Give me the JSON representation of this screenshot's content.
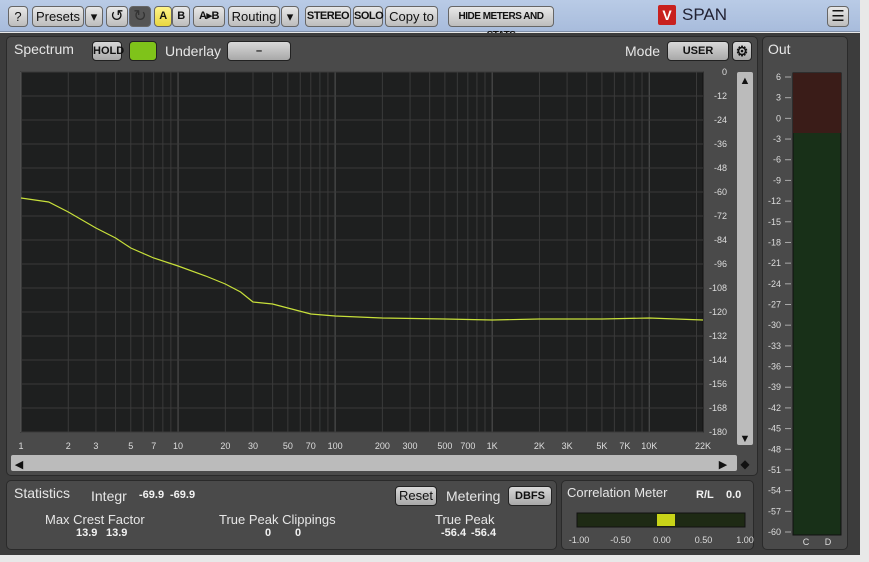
{
  "toolbar": {
    "help": "?",
    "presets": "Presets",
    "dropdown": "▾",
    "undo": "↺",
    "redo": "↻",
    "a": "A",
    "b": "B",
    "ab": "A▸B",
    "routing": "Routing",
    "stereo": "STEREO",
    "solo": "SOLO",
    "copy_to": "Copy to",
    "hide_meters": "HIDE METERS AND STATS",
    "brand": "SPAN",
    "menu": "☰"
  },
  "spectrum": {
    "tab": "Spectrum",
    "hold": "HOLD",
    "hold_on_color": "#7fc31a",
    "underlay_label": "Underlay",
    "underlay_value": "–",
    "mode_label": "Mode",
    "mode_value": "USER",
    "line_color": "#c8e03a"
  },
  "chart_data": {
    "type": "line",
    "x_scale": "log",
    "xlim": [
      1,
      22000
    ],
    "ylim": [
      -180,
      0
    ],
    "x_ticks": [
      {
        "v": 1,
        "t": "1"
      },
      {
        "v": 2,
        "t": "2"
      },
      {
        "v": 3,
        "t": "3"
      },
      {
        "v": 5,
        "t": "5"
      },
      {
        "v": 7,
        "t": "7"
      },
      {
        "v": 10,
        "t": "10"
      },
      {
        "v": 20,
        "t": "20"
      },
      {
        "v": 30,
        "t": "30"
      },
      {
        "v": 50,
        "t": "50"
      },
      {
        "v": 70,
        "t": "70"
      },
      {
        "v": 100,
        "t": "100"
      },
      {
        "v": 200,
        "t": "200"
      },
      {
        "v": 300,
        "t": "300"
      },
      {
        "v": 500,
        "t": "500"
      },
      {
        "v": 700,
        "t": "700"
      },
      {
        "v": 1000,
        "t": "1K"
      },
      {
        "v": 2000,
        "t": "2K"
      },
      {
        "v": 3000,
        "t": "3K"
      },
      {
        "v": 5000,
        "t": "5K"
      },
      {
        "v": 7000,
        "t": "7K"
      },
      {
        "v": 10000,
        "t": "10K"
      },
      {
        "v": 22000,
        "t": "22K"
      }
    ],
    "y_ticks": [
      "0",
      "-12",
      "-24",
      "-36",
      "-48",
      "-60",
      "-72",
      "-84",
      "-96",
      "-108",
      "-120",
      "-132",
      "-144",
      "-156",
      "-168",
      "-180"
    ],
    "x": [
      1,
      1.5,
      2,
      3,
      4,
      5,
      7,
      10,
      15,
      20,
      25,
      30,
      40,
      50,
      70,
      100,
      200,
      500,
      1000,
      2000,
      5000,
      10000,
      22000
    ],
    "y": [
      -63,
      -65,
      -70,
      -78,
      -83,
      -88,
      -93,
      -97,
      -102,
      -106,
      -110,
      -115,
      -116,
      -118,
      -121,
      -122,
      -123,
      -123.5,
      -124,
      -123.5,
      -123.5,
      -123,
      -124
    ]
  },
  "out": {
    "tab": "Out",
    "scale": [
      "6",
      "3",
      "0",
      "-3",
      "-6",
      "-9",
      "-12",
      "-15",
      "-18",
      "-21",
      "-24",
      "-27",
      "-30",
      "-33",
      "-36",
      "-39",
      "-42",
      "-45",
      "-48",
      "-51",
      "-54",
      "-57",
      "-60"
    ],
    "channels": [
      "C",
      "D"
    ]
  },
  "stats": {
    "tab": "Statistics",
    "integr_label": "Integr",
    "integr": [
      "-69.9",
      "-69.9"
    ],
    "reset": "Reset",
    "metering_label": "Metering",
    "metering_value": "DBFS",
    "crest_label": "Max Crest Factor",
    "crest": [
      "13.9",
      "13.9"
    ],
    "clip_label": "True Peak Clippings",
    "clip": [
      "0",
      "0"
    ],
    "peak_label": "True Peak",
    "peak": [
      "-56.4",
      "-56.4"
    ]
  },
  "correlation": {
    "tab": "Correlation Meter",
    "rl_label": "R/L",
    "rl_value": "0.0",
    "value": 0.0,
    "scale": [
      "-1.00",
      "-0.50",
      "0.00",
      "0.50",
      "1.00"
    ]
  }
}
